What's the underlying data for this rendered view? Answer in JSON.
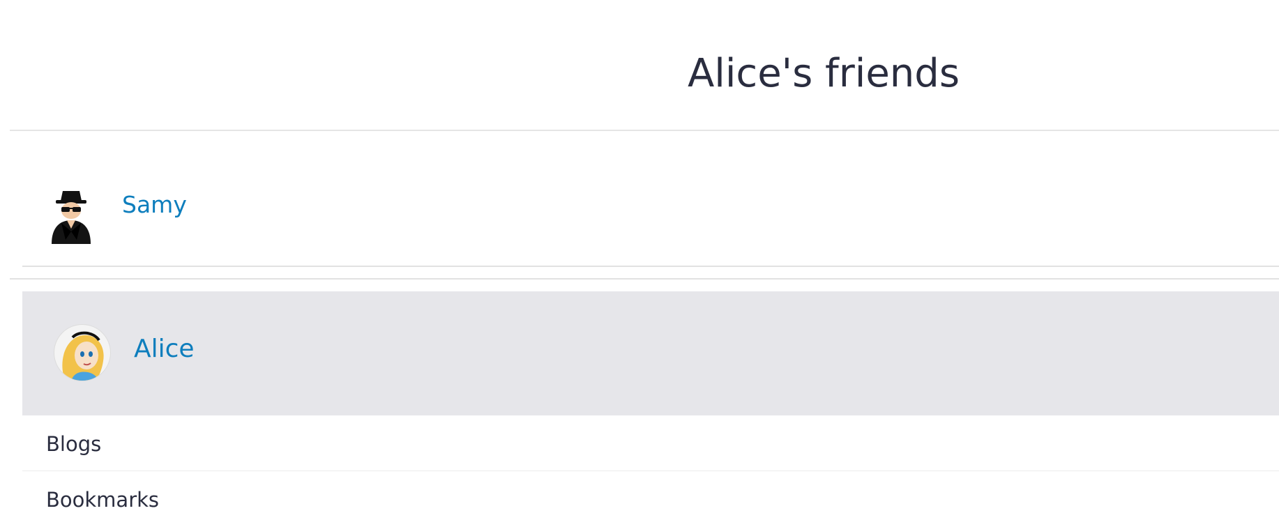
{
  "header": {
    "title": "Alice's friends"
  },
  "friends": [
    {
      "name": "Samy",
      "avatar_icon": "spy-icon"
    }
  ],
  "owner": {
    "name": "Alice",
    "avatar_icon": "alice-avatar-icon"
  },
  "owner_menu": [
    {
      "label": "Blogs"
    },
    {
      "label": "Bookmarks"
    }
  ],
  "colors": {
    "link": "#0e7ebd",
    "text": "#2a2d3f",
    "owner_block_bg": "#e6e6ea",
    "rule": "#e2e2e2"
  }
}
